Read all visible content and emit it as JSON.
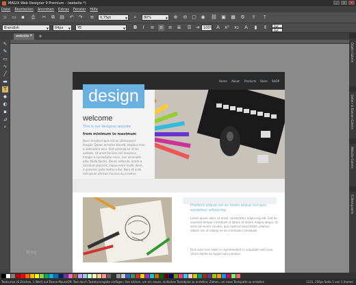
{
  "window": {
    "title": "MAGIX Web Designer 9 Premium - (website *)",
    "min_label": "_",
    "max_label": "□",
    "close_label": "x"
  },
  "menu": [
    "Datei",
    "Bearbeiten",
    "Anordnen",
    "Extras",
    "Fenster",
    "Hilfe"
  ],
  "toolbar1": {
    "zoom": "0,75pt",
    "percent": "80%"
  },
  "toolbar2": {
    "font": "Brandish",
    "size": "84px",
    "style": "YE",
    "percent": "100%",
    "r1": "0pt",
    "r2": "0pt"
  },
  "tab": {
    "label": "website *",
    "close": "x",
    "add": "+"
  },
  "right_panel": [
    "Objekt-Galerie",
    "Seiten- & Ebenen-Galerie",
    "Website-Galerie",
    "Fülltextgalerie"
  ],
  "site": {
    "nav": [
      "Home",
      "About",
      "Products",
      "Store",
      "SHOP"
    ],
    "logo": "design",
    "welcome": "welcome",
    "subtitle1": "This is our designer website",
    "subtitle2": "from minimum to maximum",
    "body1": "Nunc tincidunt quis elit ac ullamcorper feugiat. Donec at tortor blandit, dapibus eros a, bibendum arcu. Sed vehicula ex id leo sodales, sit amet facilisis nisi maximus. Integer a consectetur nunc, non venenatis odio. Nulla facilisi. Donec vehicula, lorem a tincidunt placerat, massa enim mollis diam, in pulvinar justo metus a dui. Nam at nulla sed ipsum ultrices rhoncus eu a metus.",
    "heading2": "Proident aliquip est eu lorem aliqua nisi quis excepteur adipiscing",
    "body2": "Lorem ipsum dolor sit amet, consectetur adipiscing elit. Sed do eiusmod tempor incididunt ut labore et dolore magna aliqua. Ut enim ad minim veniam, quis nostrud exercitation ullamco laboris nisi ut aliquip ex ea commodo consequat.",
    "body3": "Duis aute irure dolor in reprehenderit in voluptate velit esse cillum dolore eu fugiat nulla pariatur.",
    "blog": "Blog"
  },
  "colors": {
    "accent": "#6ab0e0"
  },
  "palette": [
    "#000000",
    "#ffffff",
    "#7f7f7f",
    "#c00000",
    "#ff0000",
    "#ff6600",
    "#ffc000",
    "#ffff00",
    "#92d050",
    "#00b050",
    "#00b0f0",
    "#0070c0",
    "#002060",
    "#7030a0",
    "#ff66cc",
    "#996633",
    "#cc99ff",
    "#99ccff",
    "#ccffcc",
    "#ffffcc",
    "#ffcc99",
    "#ff9999",
    "#666666",
    "#333333",
    "#999999",
    "#cccccc",
    "#3366cc",
    "#339966",
    "#cc3333",
    "#ffcc00",
    "#9933cc",
    "#00cccc",
    "#cc6600",
    "#006600",
    "#660000",
    "#000066",
    "#669900",
    "#ff3399",
    "#33ccff",
    "#ffcccc",
    "#cccc00",
    "#009999",
    "#993300",
    "#663399",
    "#99cc00",
    "#ff9900",
    "#0099ff",
    "#cc0066",
    "#66ff66",
    "#ff6666"
  ],
  "status": {
    "left": "Textcursor (6 Zeichen, 1 Wort) auf Ebene MouseOff: Text durch Tastatureingabe einfügen; hier klicken, um ein neues, einfaches Textobjekt zu erstellen; Ziehen, um neue Textspalte zu erstellen",
    "right": "1331, 256px  Seite 1 von 1 (home)"
  }
}
